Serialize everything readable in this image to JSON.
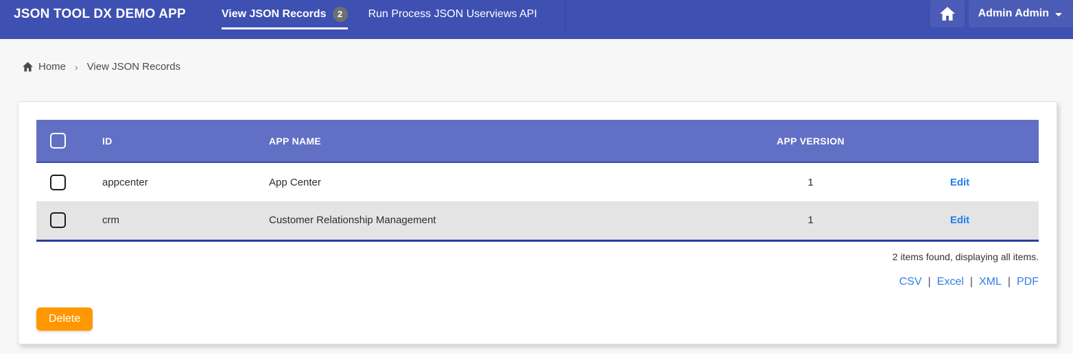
{
  "navbar": {
    "title": "JSON TOOL DX DEMO APP",
    "tabs": [
      {
        "label": "View JSON Records",
        "badge": "2",
        "active": true
      },
      {
        "label": "Run Process JSON Userviews API",
        "active": false
      }
    ],
    "user_menu_label": "Admin Admin"
  },
  "breadcrumb": {
    "home_label": "Home",
    "separator": "›",
    "current": "View JSON Records"
  },
  "table": {
    "headers": {
      "id": "ID",
      "app_name": "APP NAME",
      "app_version": "APP VERSION"
    },
    "rows": [
      {
        "id": "appcenter",
        "app_name": "App Center",
        "app_version": "1",
        "action": "Edit"
      },
      {
        "id": "crm",
        "app_name": "Customer Relationship Management",
        "app_version": "1",
        "action": "Edit"
      }
    ],
    "summary": "2 items found, displaying all items.",
    "export_links": [
      "CSV",
      "Excel",
      "XML",
      "PDF"
    ],
    "export_separator": "|"
  },
  "actions": {
    "delete_label": "Delete"
  },
  "icons": {
    "navbar_home": "home-icon",
    "breadcrumb_home": "home-icon",
    "user_caret": "chevron-down-icon"
  },
  "colors": {
    "navbar_bg": "#3e50b2",
    "table_header_bg": "#6170c4",
    "row_alt_bg": "#e4e4e4",
    "table_border_navy": "#283d9c",
    "link_blue": "#2e7ee5",
    "edit_link_blue": "#1f7fe8",
    "delete_orange": "#ff9800",
    "badge_gray": "#6f6f6f",
    "page_bg": "#f7f7f8"
  }
}
